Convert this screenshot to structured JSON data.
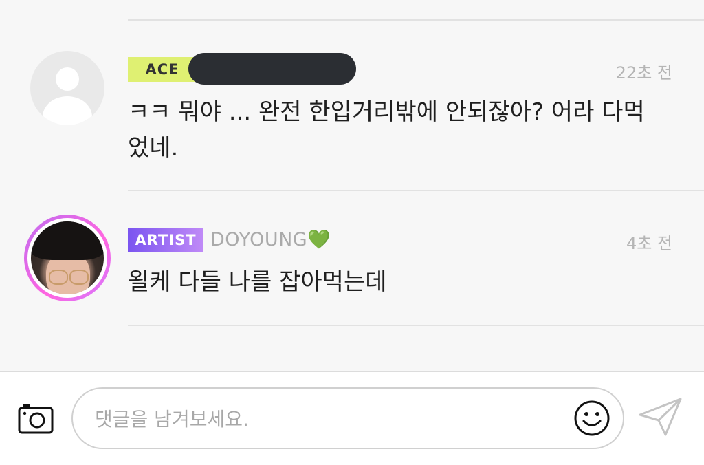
{
  "comments": [
    {
      "badge": "ACE",
      "time": "22초 전",
      "text": "ㅋㅋ 뭐야 ... 완전 한입거리밖에 안되잖아? 어라 다먹었네."
    },
    {
      "badge": "ARTIST",
      "username": "DOYOUNG",
      "username_emoji": "💚",
      "time": "4초 전",
      "text": "욀케 다들 나를 잡아먹는데"
    }
  ],
  "composer": {
    "placeholder": "댓글을 남겨보세요.",
    "value": ""
  },
  "icons": {
    "camera": "camera-icon",
    "emoji": "smiley-icon",
    "send": "send-icon",
    "default_avatar": "default-avatar-icon"
  },
  "colors": {
    "ace_badge": "#dff072",
    "artist_badge_start": "#7b55f0",
    "artist_badge_end": "#c08af7",
    "heart": "#21c24a",
    "ring": "#ff66e0"
  }
}
